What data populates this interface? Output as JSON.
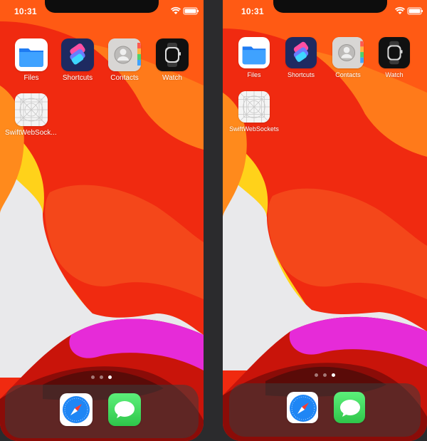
{
  "screens": [
    {
      "status": {
        "time": "10:31"
      },
      "apps": [
        {
          "label": "Files",
          "icon": "files-icon"
        },
        {
          "label": "Shortcuts",
          "icon": "shortcuts-icon"
        },
        {
          "label": "Contacts",
          "icon": "contacts-icon"
        },
        {
          "label": "Watch",
          "icon": "watch-icon"
        },
        {
          "label": "SwiftWebSock...",
          "icon": "blank-app-icon"
        }
      ],
      "dock": [
        {
          "icon": "safari-icon"
        },
        {
          "icon": "messages-icon"
        }
      ],
      "page_indicator": {
        "pages": 3,
        "current": 3
      }
    },
    {
      "status": {
        "time": "10:31"
      },
      "apps": [
        {
          "label": "Files",
          "icon": "files-icon"
        },
        {
          "label": "Shortcuts",
          "icon": "shortcuts-icon"
        },
        {
          "label": "Contacts",
          "icon": "contacts-icon"
        },
        {
          "label": "Watch",
          "icon": "watch-icon"
        },
        {
          "label": "SwiftWebSockets",
          "icon": "blank-app-icon"
        }
      ],
      "dock": [
        {
          "icon": "safari-icon"
        },
        {
          "icon": "messages-icon"
        }
      ],
      "page_indicator": {
        "pages": 3,
        "current": 3
      }
    }
  ],
  "colors": {
    "wallpaper_red": "#f02a10",
    "wallpaper_orange": "#ff7a1a",
    "wallpaper_magenta": "#e62bd8",
    "wallpaper_light": "#e8e8ea",
    "device_frame": "#2b2b2d"
  }
}
